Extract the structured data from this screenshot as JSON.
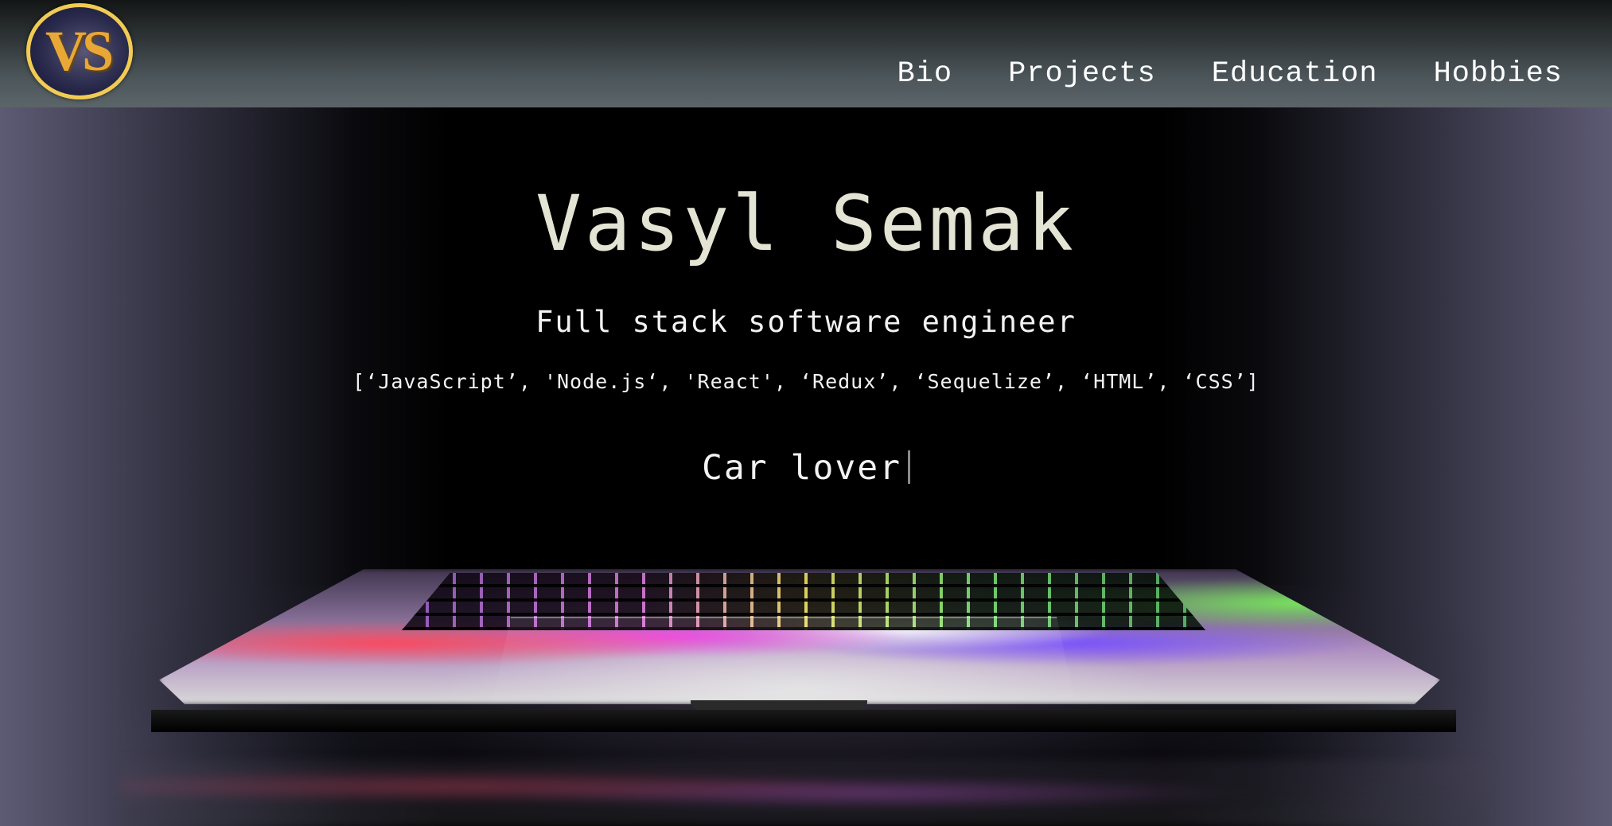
{
  "logo": {
    "text": "VS"
  },
  "nav": {
    "items": [
      {
        "label": "Bio"
      },
      {
        "label": "Projects"
      },
      {
        "label": "Education"
      },
      {
        "label": "Hobbies"
      }
    ]
  },
  "hero": {
    "name": "Vasyl Semak",
    "role": "Full stack software engineer",
    "skills": "[‘JavaScript’, 'Node.js‘, 'React', ‘Redux’, ‘Sequelize’, ‘HTML’, ‘CSS’]",
    "typed_text": "Car lover"
  },
  "colors": {
    "logo_border": "#f1cb52",
    "logo_text": "#e9a836",
    "name_text": "#e4e4d4"
  }
}
